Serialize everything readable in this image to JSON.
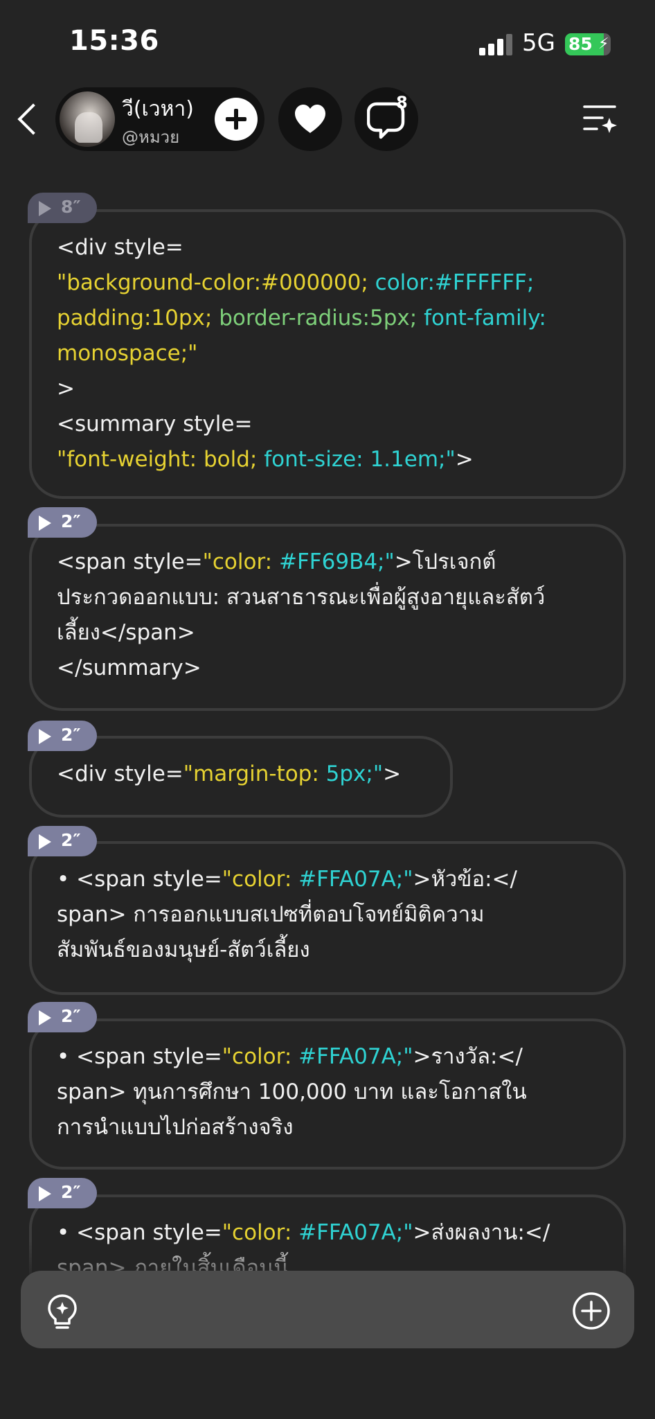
{
  "status_bar": {
    "time": "15:36",
    "network": "5G",
    "battery": "85",
    "battery_level": 0.85
  },
  "header": {
    "profile_name": "วี(เวหา)",
    "profile_handle": "@หมวย",
    "comment_count": "8"
  },
  "messages": [
    {
      "duration": "8″",
      "lines": [
        [
          {
            "t": "<div style="
          }
        ],
        [
          {
            "t": "\"background-color:#000000; ",
            "c": "yellow"
          },
          {
            "t": "color:#FFFFFF;",
            "c": "cyan"
          }
        ],
        [
          {
            "t": "padding:10px; ",
            "c": "yellow"
          },
          {
            "t": "border-radius:5px; ",
            "c": "green"
          },
          {
            "t": "font-family:",
            "c": "cyan"
          }
        ],
        [
          {
            "t": "monospace;\"",
            "c": "yellow"
          }
        ],
        [
          {
            "t": ">"
          }
        ],
        [
          {
            "t": "<summary style="
          }
        ],
        [
          {
            "t": "\"font-weight: bold; ",
            "c": "yellow"
          },
          {
            "t": "font-size: 1.1em;\"",
            "c": "cyan"
          },
          {
            "t": ">"
          }
        ]
      ]
    },
    {
      "duration": "2″",
      "lines": [
        [
          {
            "t": "<span style="
          },
          {
            "t": "\"color: ",
            "c": "yellow"
          },
          {
            "t": "#FF69B4;\"",
            "c": "cyan"
          },
          {
            "t": ">โปรเจกต์"
          }
        ],
        [
          {
            "t": "ประกวดออกแบบ: สวนสาธารณะเพื่อผู้สูงอายุและสัตว์"
          }
        ],
        [
          {
            "t": "เลี้ยง</span>"
          }
        ],
        [
          {
            "t": "</summary>"
          }
        ]
      ]
    },
    {
      "duration": "2″",
      "lines": [
        [
          {
            "t": "<div style="
          },
          {
            "t": "\"margin-top: ",
            "c": "yellow"
          },
          {
            "t": "5px;\"",
            "c": "cyan"
          },
          {
            "t": ">"
          }
        ]
      ]
    },
    {
      "duration": "2″",
      "lines": [
        [
          {
            "t": "• <span style="
          },
          {
            "t": "\"color: ",
            "c": "yellow"
          },
          {
            "t": "#FFA07A;\"",
            "c": "cyan"
          },
          {
            "t": ">หัวข้อ:</"
          }
        ],
        [
          {
            "t": "span> การออกแบบสเปซที่ตอบโจทย์มิติความ"
          }
        ],
        [
          {
            "t": "สัมพันธ์ของมนุษย์-สัตว์เลี้ยง"
          }
        ]
      ]
    },
    {
      "duration": "2″",
      "lines": [
        [
          {
            "t": "• <span style="
          },
          {
            "t": "\"color: ",
            "c": "yellow"
          },
          {
            "t": "#FFA07A;\"",
            "c": "cyan"
          },
          {
            "t": ">รางวัล:</"
          }
        ],
        [
          {
            "t": "span> ทุนการศึกษา 100,000 บาท และโอกาสใน"
          }
        ],
        [
          {
            "t": "การนำแบบไปก่อสร้างจริง"
          }
        ]
      ]
    },
    {
      "duration": "2″",
      "lines": [
        [
          {
            "t": "• <span style="
          },
          {
            "t": "\"color: ",
            "c": "yellow"
          },
          {
            "t": "#FFA07A;\"",
            "c": "cyan"
          },
          {
            "t": ">ส่งผลงาน:</"
          }
        ],
        [
          {
            "t": "span> ภายในสิ้นเดือนนี้"
          }
        ]
      ]
    }
  ],
  "colors": {
    "background": "#242424",
    "bubble_border": "#3c3c3c",
    "tag": "#7d7f9e",
    "yellow": "#e6d232",
    "cyan": "#2fd3d3",
    "green": "#7ed07a",
    "battery": "#34c759"
  },
  "icons": {
    "back": "chevron-left-icon",
    "follow": "plus-icon",
    "like": "heart-icon",
    "comment": "speech-bubble-icon",
    "menu": "list-sparkle-icon",
    "idea": "lightbulb-icon",
    "add": "plus-circle-icon"
  }
}
